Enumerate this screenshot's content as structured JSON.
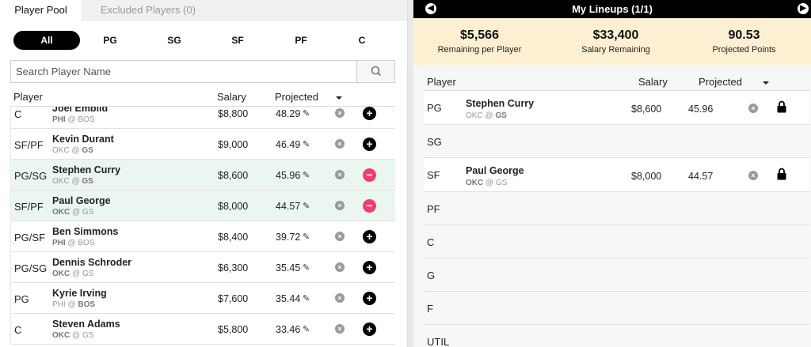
{
  "tabs": [
    {
      "label": "Player Pool",
      "active": true
    },
    {
      "label": "Excluded Players (0)",
      "active": false
    }
  ],
  "position_filters": [
    {
      "label": "All",
      "active": true
    },
    {
      "label": "PG"
    },
    {
      "label": "SG"
    },
    {
      "label": "SF"
    },
    {
      "label": "PF"
    },
    {
      "label": "C"
    }
  ],
  "search": {
    "placeholder": "Search Player Name"
  },
  "pool_headers": {
    "player": "Player",
    "salary": "Salary",
    "projected": "Projected"
  },
  "pool_rows": [
    {
      "pos": "C",
      "name": "Joel Embiid",
      "team": "PHI",
      "at": "@",
      "opp": "BOS",
      "bold_team": "team",
      "salary": "$8,800",
      "projected": "48.29",
      "action": "add",
      "selected": false
    },
    {
      "pos": "SF/PF",
      "name": "Kevin Durant",
      "team": "OKC",
      "at": "@",
      "opp": "GS",
      "bold_team": "opp",
      "salary": "$9,000",
      "projected": "46.49",
      "action": "add",
      "selected": false
    },
    {
      "pos": "PG/SG",
      "name": "Stephen Curry",
      "team": "OKC",
      "at": "@",
      "opp": "GS",
      "bold_team": "opp",
      "salary": "$8,600",
      "projected": "45.96",
      "action": "remove",
      "selected": true
    },
    {
      "pos": "SF/PF",
      "name": "Paul George",
      "team": "OKC",
      "at": "@",
      "opp": "GS",
      "bold_team": "team",
      "salary": "$8,000",
      "projected": "44.57",
      "action": "remove",
      "selected": true
    },
    {
      "pos": "PG/SF",
      "name": "Ben Simmons",
      "team": "PHI",
      "at": "@",
      "opp": "BOS",
      "bold_team": "team",
      "salary": "$8,400",
      "projected": "39.72",
      "action": "add",
      "selected": false
    },
    {
      "pos": "PG/SG",
      "name": "Dennis Schroder",
      "team": "OKC",
      "at": "@",
      "opp": "GS",
      "bold_team": "team",
      "salary": "$6,300",
      "projected": "35.45",
      "action": "add",
      "selected": false
    },
    {
      "pos": "PG",
      "name": "Kyrie Irving",
      "team": "PHI",
      "at": "@",
      "opp": "BOS",
      "bold_team": "opp",
      "salary": "$7,600",
      "projected": "35.44",
      "action": "add",
      "selected": false
    },
    {
      "pos": "C",
      "name": "Steven Adams",
      "team": "OKC",
      "at": "@",
      "opp": "GS",
      "bold_team": "team",
      "salary": "$5,800",
      "projected": "33.46",
      "action": "add",
      "selected": false
    }
  ],
  "lineup": {
    "title": "My Lineups (1/1)",
    "stats": [
      {
        "value": "$5,566",
        "label": "Remaining per Player"
      },
      {
        "value": "$33,400",
        "label": "Salary Remaining"
      },
      {
        "value": "90.53",
        "label": "Projected Points"
      }
    ],
    "headers": {
      "player": "Player",
      "salary": "Salary",
      "projected": "Projected"
    },
    "slots": [
      {
        "slot": "PG",
        "name": "Stephen Curry",
        "team": "OKC",
        "at": "@",
        "opp": "GS",
        "bold_team": "opp",
        "salary": "$8,600",
        "projected": "45.96",
        "locked": true
      },
      {
        "slot": "SG"
      },
      {
        "slot": "SF",
        "name": "Paul George",
        "team": "OKC",
        "at": "@",
        "opp": "GS",
        "bold_team": "team",
        "salary": "$8,000",
        "projected": "44.57",
        "locked": true
      },
      {
        "slot": "PF"
      },
      {
        "slot": "C"
      },
      {
        "slot": "G"
      },
      {
        "slot": "F"
      },
      {
        "slot": "UTIL"
      }
    ]
  },
  "colors": {
    "accent_remove": "#ee3f6a",
    "selected_row": "#eaf6ef",
    "stats_bg": "#fdf0d2"
  },
  "icons": {
    "search": "search-icon",
    "edit": "pencil-icon",
    "exclude": "x-circle-icon",
    "add": "plus-circle-icon",
    "remove": "minus-circle-icon",
    "lock": "lock-icon",
    "prev": "arrow-left-circle-icon",
    "next": "arrow-right-circle-icon",
    "sort": "caret-down-icon"
  }
}
